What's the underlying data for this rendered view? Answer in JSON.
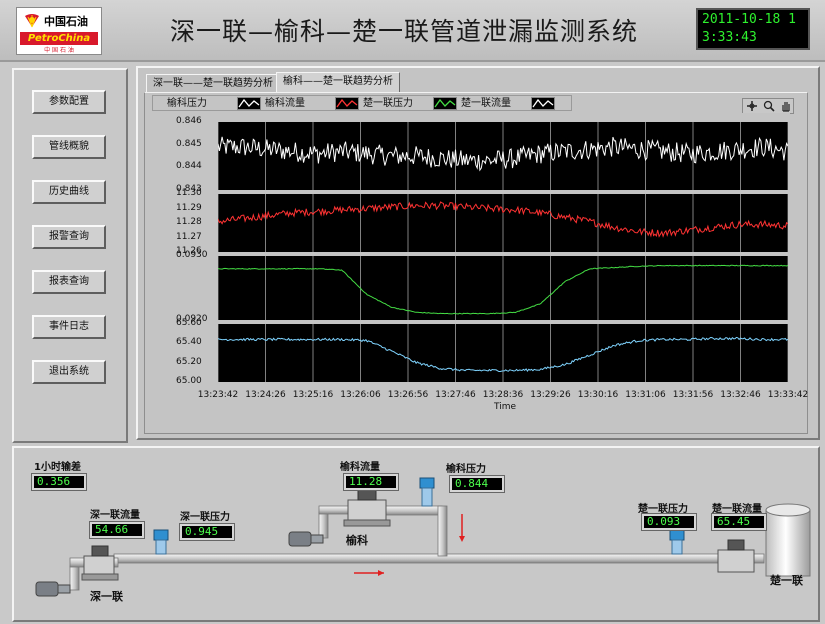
{
  "header": {
    "logo_cn": "中国石油",
    "logo_en": "PetroChina",
    "logo_cn_small": "中 国 石 油",
    "title": "深一联—榆科—楚一联管道泄漏监测系统",
    "datetime": "2011-10-18 13:33:43"
  },
  "nav": {
    "items": [
      "参数配置",
      "管线概貌",
      "历史曲线",
      "报警查询",
      "报表查询",
      "事件日志",
      "退出系统"
    ]
  },
  "tabs": [
    {
      "label": "深一联——楚一联趋势分析",
      "active": false
    },
    {
      "label": "榆科——楚一联趋势分析",
      "active": true
    }
  ],
  "legend": [
    {
      "label": "榆科压力",
      "color": "#ffffff"
    },
    {
      "label": "榆科流量",
      "color": "#ff3333"
    },
    {
      "label": "楚一联压力",
      "color": "#44dd44"
    },
    {
      "label": "楚一联流量",
      "color": "#7fd4ff"
    }
  ],
  "tools": [
    "plus-cross-icon",
    "magnifier-icon",
    "hand-icon"
  ],
  "chart_data": {
    "type": "line",
    "xlabel": "Time",
    "x_ticks": [
      "13:23:42",
      "13:24:26",
      "13:25:16",
      "13:26:06",
      "13:26:56",
      "13:27:46",
      "13:28:36",
      "13:29:26",
      "13:30:16",
      "13:31:06",
      "13:31:56",
      "13:32:46",
      "13:33:42"
    ],
    "grid": true,
    "panels": [
      {
        "name": "榆科压力",
        "color": "#ffffff",
        "yticks": [
          "0.846",
          "0.845",
          "0.844",
          "0.843"
        ],
        "ylim": [
          0.843,
          0.846
        ],
        "trend": [
          0.8449,
          0.8449,
          0.8448,
          0.8447,
          0.8446,
          0.8447,
          0.8446,
          0.8445,
          0.8445,
          0.8444,
          0.8443,
          0.8443,
          0.8444,
          0.8446,
          0.8447,
          0.8448,
          0.8449,
          0.8448,
          0.8447,
          0.8446,
          0.8447,
          0.8448,
          0.8449,
          0.8447
        ],
        "noise": 0.00045
      },
      {
        "name": "榆科流量",
        "color": "#ff3333",
        "yticks": [
          "11.30",
          "11.29",
          "11.28",
          "11.27",
          "11.26"
        ],
        "ylim": [
          11.26,
          11.3
        ],
        "trend": [
          11.281,
          11.283,
          11.285,
          11.287,
          11.288,
          11.289,
          11.29,
          11.291,
          11.292,
          11.292,
          11.291,
          11.29,
          11.289,
          11.287,
          11.284,
          11.281,
          11.277,
          11.274,
          11.273,
          11.275,
          11.277,
          11.279,
          11.279,
          11.278
        ],
        "noise": 0.0025
      },
      {
        "name": "楚一联压力",
        "color": "#44dd44",
        "yticks": [
          "0.0930",
          "0.0920"
        ],
        "ylim": [
          0.092,
          0.093
        ],
        "trend": [
          0.0928,
          0.0928,
          0.0928,
          0.0928,
          0.0928,
          0.09278,
          0.0924,
          0.0922,
          0.09212,
          0.0921,
          0.0921,
          0.0921,
          0.09212,
          0.09225,
          0.0926,
          0.0928,
          0.09282,
          0.09284,
          0.09285,
          0.09285,
          0.09285,
          0.09285,
          0.09285,
          0.09285
        ],
        "noise": 6e-06
      },
      {
        "name": "楚一联流量",
        "color": "#7fd4ff",
        "yticks": [
          "65.60",
          "65.40",
          "65.20",
          "65.00"
        ],
        "ylim": [
          65.0,
          65.6
        ],
        "trend": [
          65.44,
          65.44,
          65.44,
          65.44,
          65.44,
          65.44,
          65.43,
          65.32,
          65.2,
          65.14,
          65.12,
          65.12,
          65.12,
          65.13,
          65.18,
          65.28,
          65.38,
          65.43,
          65.44,
          65.44,
          65.45,
          65.45,
          65.44,
          65.44
        ],
        "noise": 0.012
      }
    ]
  },
  "schematic": {
    "diff_label": "1小时输差",
    "diff_value": "0.356",
    "shen_flow_label": "深一联流量",
    "shen_flow_value": "54.66",
    "shen_press_label": "深一联压力",
    "shen_press_value": "0.945",
    "yuke_flow_label": "榆科流量",
    "yuke_flow_value": "11.28",
    "yuke_press_label": "榆科压力",
    "yuke_press_value": "0.844",
    "chu_press_label": "楚一联压力",
    "chu_press_value": "0.093",
    "chu_flow_label": "楚一联流量",
    "chu_flow_value": "65.45",
    "station_shen": "深一联",
    "station_yuke": "榆科",
    "station_chu": "楚一联"
  }
}
